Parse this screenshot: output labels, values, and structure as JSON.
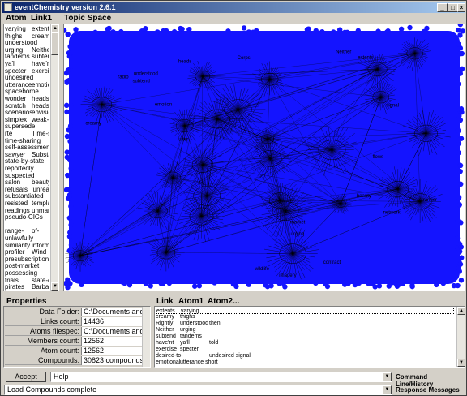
{
  "window": {
    "title": "eventChemistry  version 2.6.1",
    "controls": {
      "minimize": "_",
      "maximize": "□",
      "close": "×"
    }
  },
  "atom_panel": {
    "col_atom": "Atom",
    "col_link": "Link1",
    "rows": [
      [
        "varying",
        "extents"
      ],
      [
        "thighs",
        "creamy"
      ],
      [
        "understood",
        ""
      ],
      [
        "urging",
        "Neither"
      ],
      [
        "tandems",
        "subtend"
      ],
      [
        "ya'll",
        "have'nt"
      ],
      [
        "specter",
        "exercise"
      ],
      [
        "undesired",
        ""
      ],
      [
        "utterance",
        "emotion"
      ],
      [
        "spaceborne",
        ""
      ],
      [
        "wonder",
        "heads"
      ],
      [
        "scratch",
        "heads"
      ],
      [
        "scenarios",
        "envision"
      ],
      [
        "simplex",
        "weak-s"
      ],
      [
        "supersede",
        ""
      ],
      [
        "rte",
        "Time-sh"
      ],
      [
        "time-sharing",
        ""
      ],
      [
        "self-assessment",
        ""
      ],
      [
        "sawyer",
        "Substan"
      ],
      [
        "state-by-state",
        ""
      ],
      [
        "reportedly",
        ""
      ],
      [
        "suspected",
        ""
      ],
      [
        "salon",
        "beauty"
      ],
      [
        "refusals",
        "'unrea"
      ],
      [
        "substantiated",
        ""
      ],
      [
        "resisted",
        "templat"
      ],
      [
        "readings",
        "unmark"
      ],
      [
        "pseudo-CICs",
        ""
      ],
      [
        "",
        ""
      ],
      [
        "range-",
        "of-"
      ],
      [
        "unlawfully",
        ""
      ],
      [
        "similarity",
        "informer"
      ],
      [
        "profiler",
        "Wind"
      ],
      [
        "presubscription",
        ""
      ],
      [
        "post-market",
        ""
      ],
      [
        "possessing",
        ""
      ],
      [
        "trials",
        "state-or"
      ],
      [
        "pirates",
        "Barbary"
      ]
    ]
  },
  "topic": {
    "title": "Topic Space",
    "graph_color": "#1414ff",
    "edge_color": "#000000",
    "words": [
      "imagery",
      "wildlife",
      "contract",
      "heads",
      "signal",
      "network",
      "Corps",
      "beauty",
      "stranger",
      "market",
      "extents",
      "emotion",
      "utter",
      "flows",
      "radio",
      "subtend",
      "Neither",
      "creamy",
      "understood",
      "urging"
    ]
  },
  "properties": {
    "title": "Properties",
    "rows": [
      {
        "label": "Data Folder:",
        "value": "C:\\Documents and S"
      },
      {
        "label": "Links count:",
        "value": "14436"
      },
      {
        "label": "Atoms filespec:",
        "value": "C:\\Documents and S"
      },
      {
        "label": "Members count:",
        "value": "12562"
      },
      {
        "label": "Atom count:",
        "value": "12562"
      },
      {
        "label": "Compounds:",
        "value": "30823 compounds ex"
      }
    ]
  },
  "links_panel": {
    "col_link": "Link",
    "col_atom1": "Atom1",
    "col_atom2": "Atom2...",
    "rows": [
      [
        "extents",
        "varying",
        ""
      ],
      [
        "creamy",
        "thighs",
        ""
      ],
      [
        "Rightly",
        "understood",
        "then"
      ],
      [
        "Neither",
        "urging",
        ""
      ],
      [
        "subtend",
        "tandems",
        ""
      ],
      [
        "have'nt",
        "ya'll",
        "told"
      ],
      [
        "exercise",
        "specter",
        ""
      ],
      [
        "desired-to-",
        "",
        "undesired signal"
      ],
      [
        "emotional",
        "utterance short",
        ""
      ]
    ]
  },
  "bottom": {
    "accept_label": "Accept",
    "command_value": "Help",
    "command_label": "Command Line/History",
    "response_value": "Load Compounds complete",
    "response_label": "Response Messages"
  }
}
